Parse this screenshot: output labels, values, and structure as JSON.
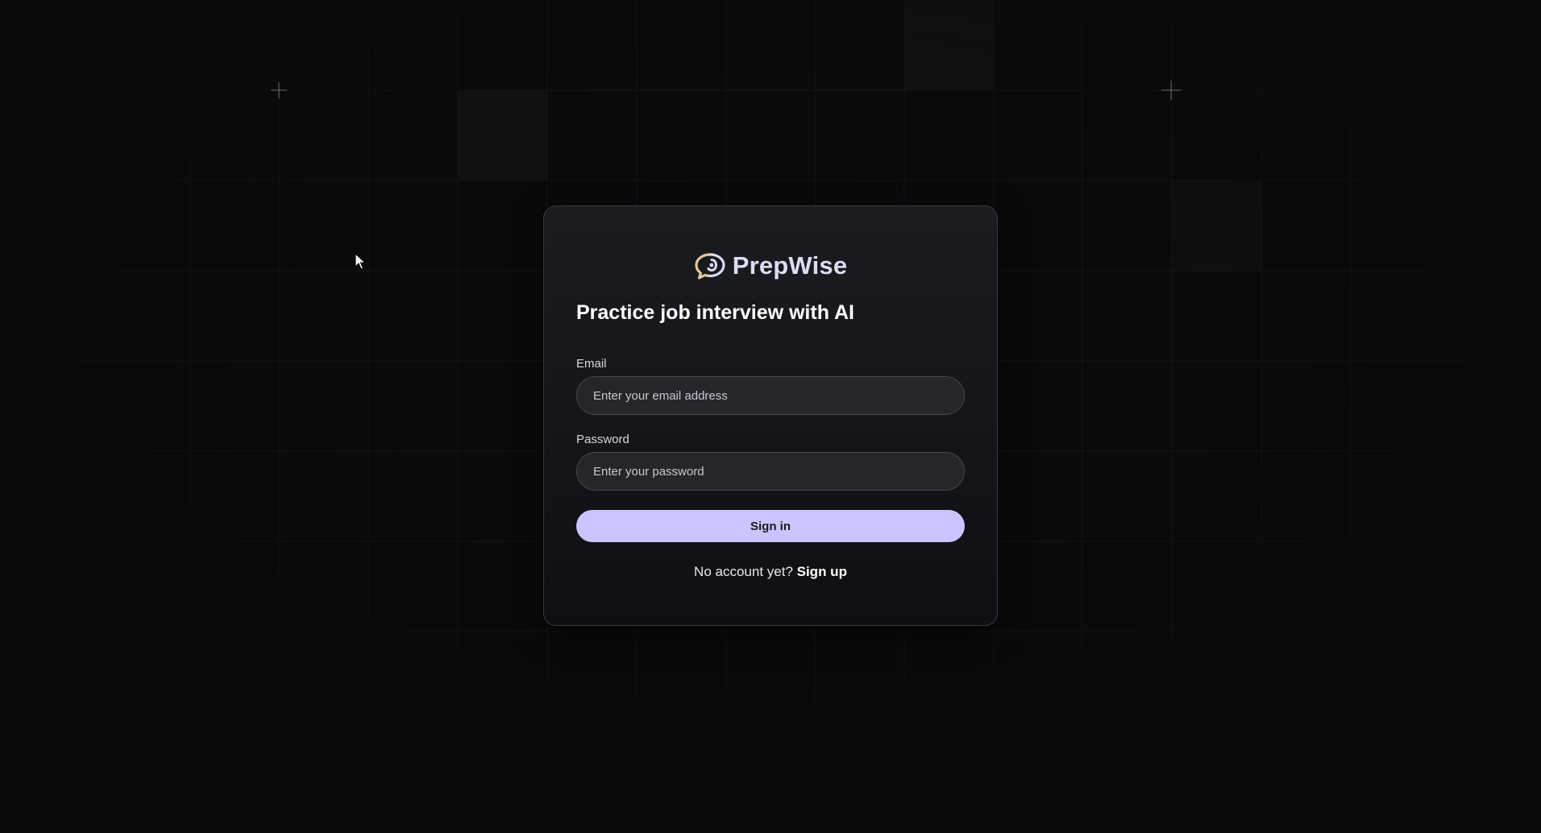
{
  "app": {
    "brand_name": "PrepWise",
    "headline": "Practice job interview with AI"
  },
  "form": {
    "email_label": "Email",
    "email_placeholder": "Enter your email address",
    "email_value": "",
    "password_label": "Password",
    "password_placeholder": "Enter your password",
    "password_value": "",
    "submit_label": "Sign in"
  },
  "footer": {
    "prompt": "No account yet? ",
    "link_label": "Sign up"
  },
  "icons": {
    "logo": "chat-bubble-logo-icon",
    "cursor": "mouse-pointer-icon"
  },
  "colors": {
    "background": "#0a0a0b",
    "card": "#1b1c20",
    "accent": "#cac5fe",
    "brand_text": "#dcdcf2",
    "logo_gold": "#e3c79f"
  }
}
